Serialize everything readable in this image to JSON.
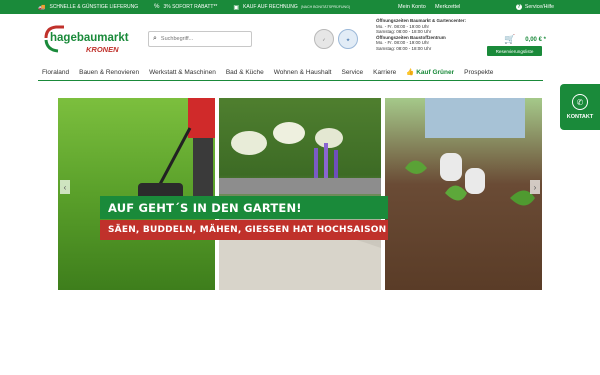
{
  "topbar": {
    "usps": [
      {
        "icon": "truck-icon",
        "label": "SCHNELLE & GÜNSTIGE LIEFERUNG"
      },
      {
        "icon": "percent-icon",
        "label": "3% SOFORT RABATT**"
      },
      {
        "icon": "wallet-icon",
        "label": "KAUF AUF RECHNUNG",
        "note": "(NACH BONITÄTSPRÜFUNG)"
      }
    ],
    "service": "Service/Hilfe"
  },
  "header": {
    "account": "Mein Konto",
    "wishlist": "Merkzettel",
    "logo_top": "hagebaumarkt",
    "logo_bottom": "KRONEN",
    "search_placeholder": "Suchbegriff...",
    "hours": [
      {
        "text": "Öffnungszeiten Baumarkt & Gartencenter:",
        "head": true
      },
      {
        "text": "Mo. - Fr. 08:00 - 19:00 Uhr",
        "head": false
      },
      {
        "text": "Samstag: 08:00 - 18:00 Uhr",
        "head": false
      },
      {
        "text": "Öffnungszeiten Baustoffzentrum",
        "head": true
      },
      {
        "text": "Mo. - Fr. 08:00 - 19:00 Uhr",
        "head": false
      },
      {
        "text": "Samstag: 08:00 - 18:00 Uhr",
        "head": false
      }
    ],
    "cart_total": "0,00 € *",
    "reserve_label": "Reservierungsliste"
  },
  "nav": [
    "Floraland",
    "Bauen & Renovieren",
    "Werkstatt & Maschinen",
    "Bad & Küche",
    "Wohnen & Haushalt",
    "Service",
    "Karriere",
    "Kauf Grüner",
    "Prospekte"
  ],
  "hero": {
    "headline": "AUF GEHT´S IN DEN GARTEN!",
    "subline": "SÄEN, BUDDELN, MÄHEN, GIESSEN HAT HOCHSAISON"
  },
  "contact": {
    "label": "KONTAKT"
  },
  "colors": {
    "brand_green": "#1a8a3a",
    "accent_red": "#c0312b"
  }
}
